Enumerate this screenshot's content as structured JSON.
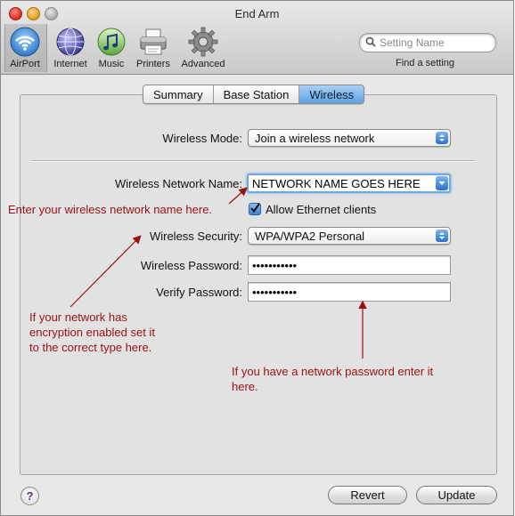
{
  "window": {
    "title": "End Arm"
  },
  "toolbar": {
    "items": [
      {
        "label": "AirPort",
        "icon": "airport-icon"
      },
      {
        "label": "Internet",
        "icon": "internet-globe-icon"
      },
      {
        "label": "Music",
        "icon": "music-icon"
      },
      {
        "label": "Printers",
        "icon": "printer-icon"
      },
      {
        "label": "Advanced",
        "icon": "gear-icon"
      }
    ],
    "search_placeholder": "Setting Name",
    "find_label": "Find a setting"
  },
  "tabs": [
    {
      "label": "Summary",
      "active": false
    },
    {
      "label": "Base Station",
      "active": false
    },
    {
      "label": "Wireless",
      "active": true
    }
  ],
  "form": {
    "wireless_mode_label": "Wireless Mode:",
    "wireless_mode_value": "Join a wireless network",
    "network_name_label": "Wireless Network Name:",
    "network_name_value": "NETWORK NAME GOES HERE",
    "allow_ethernet_label": "Allow Ethernet clients",
    "allow_ethernet_checked": true,
    "security_label": "Wireless Security:",
    "security_value": "WPA/WPA2 Personal",
    "password_label": "Wireless Password:",
    "password_value": "•••••••••••",
    "verify_label": "Verify Password:",
    "verify_value": "•••••••••••"
  },
  "annotations": {
    "network_name": "Enter your wireless network name here.",
    "security": [
      "If your network has",
      "encryption enabled set it",
      "to the correct type here."
    ],
    "password": [
      "If you have a network password enter it",
      "here."
    ]
  },
  "buttons": {
    "help": "?",
    "revert": "Revert",
    "update": "Update"
  },
  "colors": {
    "annotation": "#9a1010",
    "selection": "#5ea2e0"
  }
}
